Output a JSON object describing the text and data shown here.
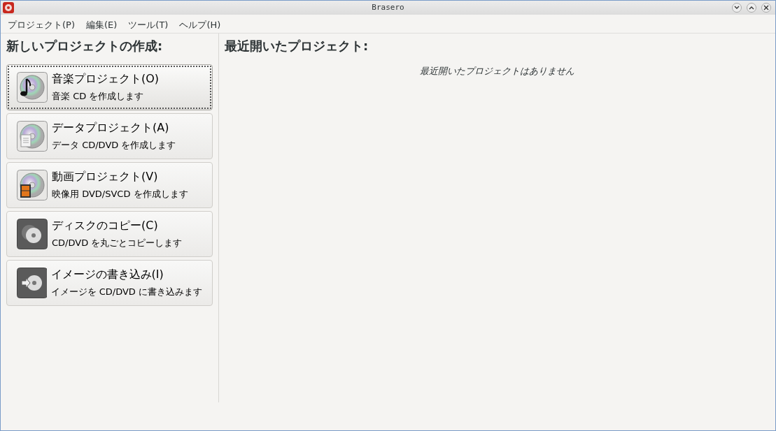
{
  "window": {
    "title": "Brasero"
  },
  "menu": [
    "プロジェクト(P)",
    "編集(E)",
    "ツール(T)",
    "ヘルプ(H)"
  ],
  "new_project": {
    "heading": "新しいプロジェクトの作成:",
    "items": [
      {
        "kind": "music",
        "title": "音楽プロジェクト(O)",
        "description": "音楽 CD を作成します",
        "focused": true
      },
      {
        "kind": "data",
        "title": "データプロジェクト(A)",
        "description": "データ CD/DVD を作成します",
        "focused": false
      },
      {
        "kind": "video",
        "title": "動画プロジェクト(V)",
        "description": "映像用 DVD/SVCD を作成します",
        "focused": false
      },
      {
        "kind": "copy",
        "title": "ディスクのコピー(C)",
        "description": "CD/DVD を丸ごとコピーします",
        "focused": false
      },
      {
        "kind": "image",
        "title": "イメージの書き込み(I)",
        "description": "イメージを CD/DVD に書き込みます",
        "focused": false
      }
    ]
  },
  "recent": {
    "heading": "最近開いたプロジェクト:",
    "empty_message": "最近開いたプロジェクトはありません"
  }
}
